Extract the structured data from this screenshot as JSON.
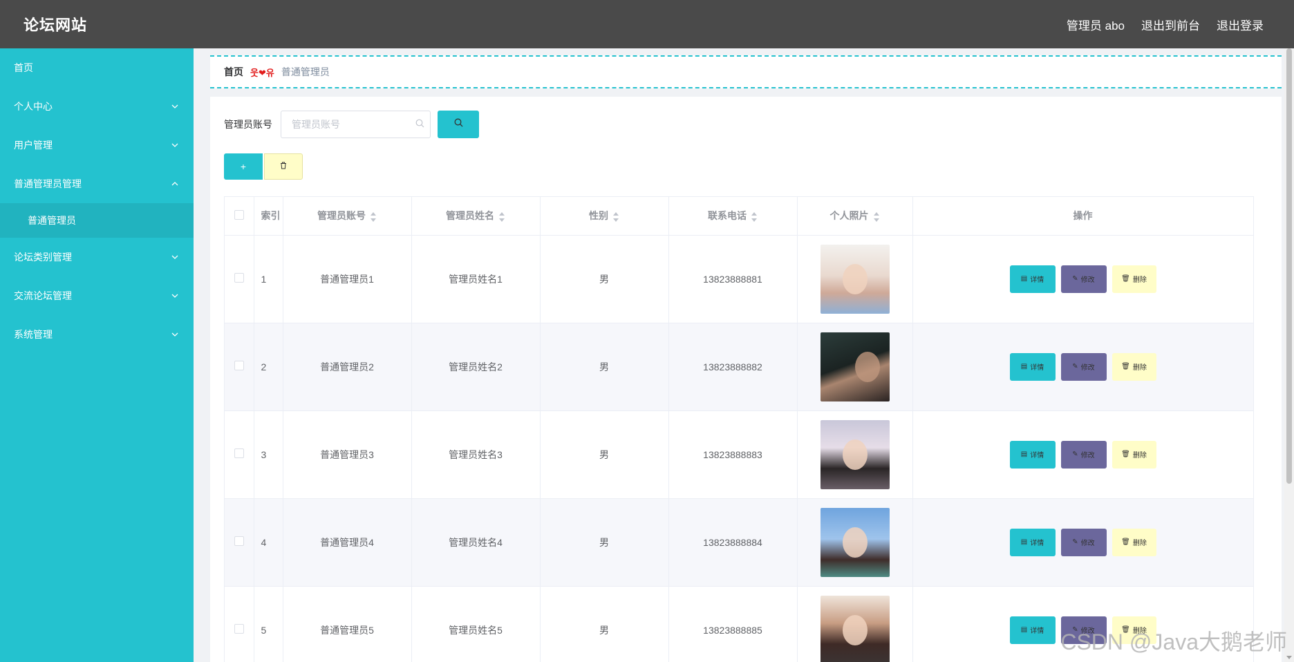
{
  "header": {
    "logo": "论坛网站",
    "user": "管理员 abo",
    "front_link": "退出到前台",
    "logout": "退出登录"
  },
  "sidebar": {
    "items": [
      {
        "label": "首页",
        "has_arrow": false
      },
      {
        "label": "个人中心",
        "has_arrow": true
      },
      {
        "label": "用户管理",
        "has_arrow": true
      },
      {
        "label": "普通管理员管理",
        "has_arrow": true,
        "expanded": true
      },
      {
        "label": "论坛类别管理",
        "has_arrow": true
      },
      {
        "label": "交流论坛管理",
        "has_arrow": true
      },
      {
        "label": "系统管理",
        "has_arrow": true
      }
    ],
    "sub_item": "普通管理员"
  },
  "breadcrumb": {
    "home": "首页",
    "separator": "웃❤유",
    "current": "普通管理员"
  },
  "search": {
    "label": "管理员账号",
    "placeholder": "管理员账号"
  },
  "table": {
    "headers": [
      "索引",
      "管理员账号",
      "管理员姓名",
      "性别",
      "联系电话",
      "个人照片",
      "操作"
    ],
    "rows": [
      {
        "index": "1",
        "account": "普通管理员1",
        "name": "管理员姓名1",
        "gender": "男",
        "phone": "13823888881"
      },
      {
        "index": "2",
        "account": "普通管理员2",
        "name": "管理员姓名2",
        "gender": "男",
        "phone": "13823888882"
      },
      {
        "index": "3",
        "account": "普通管理员3",
        "name": "管理员姓名3",
        "gender": "男",
        "phone": "13823888883"
      },
      {
        "index": "4",
        "account": "普通管理员4",
        "name": "管理员姓名4",
        "gender": "男",
        "phone": "13823888884"
      },
      {
        "index": "5",
        "account": "普通管理员5",
        "name": "管理员姓名5",
        "gender": "男",
        "phone": "13823888885"
      }
    ],
    "ops": {
      "detail": "详情",
      "edit": "修改",
      "delete": "删除"
    }
  },
  "buttons": {
    "add": "+"
  },
  "colors": {
    "accent": "#24c2cf",
    "topbar": "#4a4a4a",
    "edit": "#6b679c",
    "delete": "#fffdc8"
  },
  "watermark": "CSDN @Java大鹅老师"
}
